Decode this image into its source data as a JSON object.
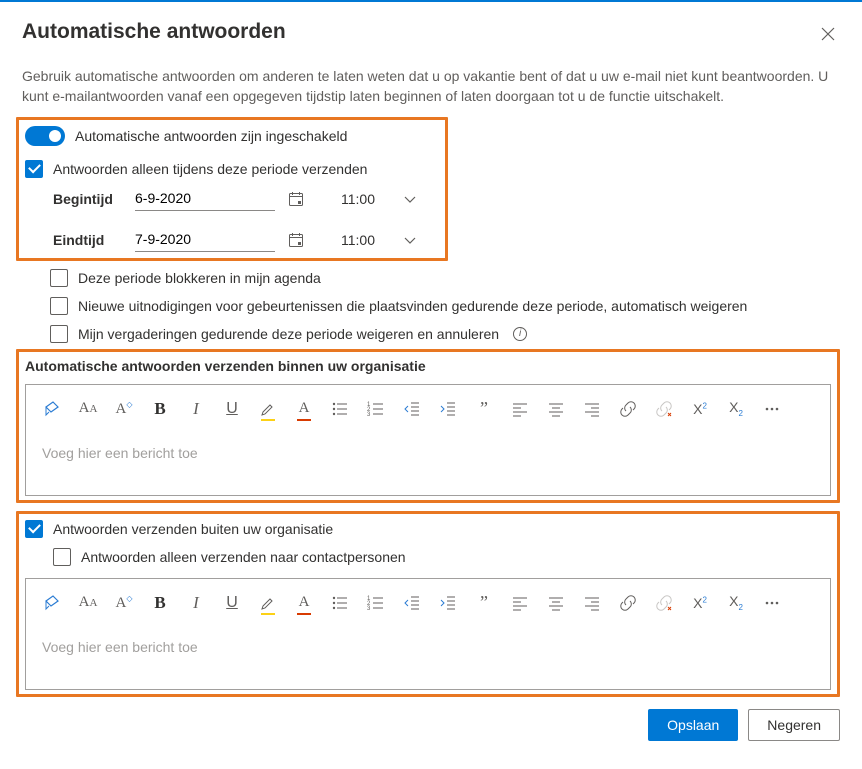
{
  "dialog": {
    "title": "Automatische antwoorden",
    "intro": "Gebruik automatische antwoorden om anderen te laten weten dat u op vakantie bent of dat u uw e-mail niet kunt beantwoorden. U kunt e-mailantwoorden vanaf een opgegeven tijdstip laten beginnen of laten doorgaan tot u de functie uitschakelt."
  },
  "main": {
    "toggle_label": "Automatische antwoorden zijn ingeschakeld",
    "period_label": "Antwoorden alleen tijdens deze periode verzenden",
    "start_label": "Begintijd",
    "end_label": "Eindtijd",
    "start_date": "6-9-2020",
    "start_time": "11:00",
    "end_date": "7-9-2020",
    "end_time": "11:00"
  },
  "options": {
    "block_calendar": "Deze periode blokkeren in mijn agenda",
    "decline_new": "Nieuwe uitnodigingen voor gebeurtenissen die plaatsvinden gedurende deze periode, automatisch weigeren",
    "cancel_meetings": "Mijn vergaderingen gedurende deze periode weigeren en annuleren"
  },
  "internal": {
    "heading": "Automatische antwoorden verzenden binnen uw organisatie",
    "placeholder": "Voeg hier een bericht toe"
  },
  "external": {
    "enable_label": "Antwoorden verzenden buiten uw organisatie",
    "contacts_only_label": "Antwoorden alleen verzenden naar contactpersonen",
    "placeholder": "Voeg hier een bericht toe"
  },
  "footer": {
    "save": "Opslaan",
    "cancel": "Negeren"
  },
  "toolbar_icons": [
    "format-painter-icon",
    "font-decrease-icon",
    "font-increase-icon",
    "bold-icon",
    "italic-icon",
    "underline-icon",
    "highlight-icon",
    "font-color-icon",
    "bullet-list-icon",
    "number-list-icon",
    "outdent-icon",
    "indent-icon",
    "quote-icon",
    "align-left-icon",
    "align-center-icon",
    "align-right-icon",
    "link-icon",
    "unlink-icon",
    "superscript-icon",
    "subscript-icon",
    "more-icon"
  ]
}
